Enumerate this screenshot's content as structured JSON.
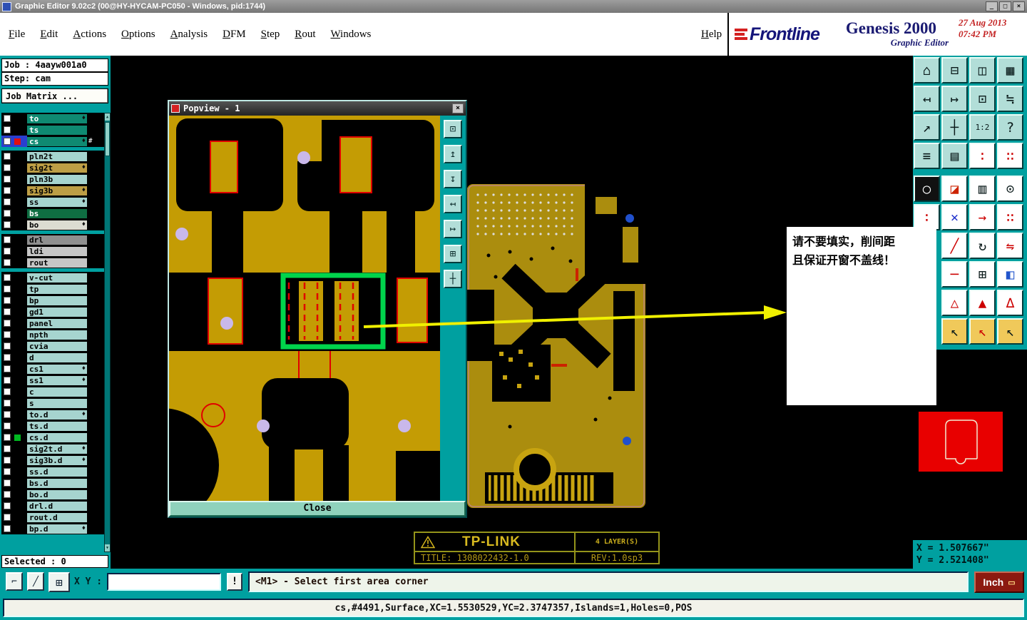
{
  "window": {
    "title": "Graphic Editor 9.02c2 (00@HY-HYCAM-PC050 - Windows, pid:1744)",
    "controls": {
      "minimize": "_",
      "maximize": "□",
      "close": "×"
    }
  },
  "menubar": {
    "items": [
      "File",
      "Edit",
      "Actions",
      "Options",
      "Analysis",
      "DFM",
      "Step",
      "Rout",
      "Windows"
    ],
    "help": "Help"
  },
  "branding": {
    "logo": "Frontline",
    "product": "Genesis 2000",
    "date": "27 Aug 2013",
    "time": "07:42 PM",
    "subtitle": "Graphic Editor"
  },
  "job_panel": {
    "job_label": "Job : 4aayw001a0",
    "step_label": "Step: cam",
    "matrix_button": "Job Matrix ...",
    "selected_label": "Selected : 0"
  },
  "layers": [
    {
      "n": "to",
      "bg": "#0f8a72",
      "fg": "#ffffff",
      "dia": true
    },
    {
      "n": "ts",
      "bg": "#0f8a72",
      "fg": "#ffffff"
    },
    {
      "n": "cs",
      "bg": "#0f8a72",
      "fg": "#ffffff",
      "dia": true,
      "chip": "#e01010",
      "cb": "#2a3fd0",
      "sfx": "#"
    },
    {
      "n": "pln2t",
      "bg": "#a6d4cf",
      "gap": true
    },
    {
      "n": "sig2t",
      "bg": "#bd9e45",
      "dia": true
    },
    {
      "n": "pln3b",
      "bg": "#a6d4cf"
    },
    {
      "n": "sig3b",
      "bg": "#bd9e45",
      "dia": true
    },
    {
      "n": "ss",
      "bg": "#a6d4cf",
      "dia": true
    },
    {
      "n": "bs",
      "bg": "#0f6e42",
      "fg": "#ffffff"
    },
    {
      "n": "bo",
      "bg": "#dcdcd2",
      "dia": true
    },
    {
      "n": "drl",
      "bg": "#8f8f8f",
      "gap": true
    },
    {
      "n": "ldi",
      "bg": "#c6c6c6"
    },
    {
      "n": "rout",
      "bg": "#c6c6c6"
    },
    {
      "n": "v-cut",
      "bg": "#a6d4cf",
      "gap": true
    },
    {
      "n": "tp",
      "bg": "#a6d4cf"
    },
    {
      "n": "bp",
      "bg": "#a6d4cf"
    },
    {
      "n": "gd1",
      "bg": "#a6d4cf"
    },
    {
      "n": "panel",
      "bg": "#a6d4cf"
    },
    {
      "n": "npth",
      "bg": "#a6d4cf"
    },
    {
      "n": "cvia",
      "bg": "#a6d4cf"
    },
    {
      "n": "d",
      "bg": "#a6d4cf"
    },
    {
      "n": "cs1",
      "bg": "#a6d4cf",
      "dia": true
    },
    {
      "n": "ss1",
      "bg": "#a6d4cf",
      "dia": true
    },
    {
      "n": "c",
      "bg": "#a6d4cf"
    },
    {
      "n": "s",
      "bg": "#a6d4cf"
    },
    {
      "n": "to.d",
      "bg": "#a6d4cf",
      "dia": true
    },
    {
      "n": "ts.d",
      "bg": "#a6d4cf"
    },
    {
      "n": "cs.d",
      "bg": "#a6d4cf",
      "chip": "#00b820"
    },
    {
      "n": "sig2t.d",
      "bg": "#a6d4cf",
      "dia": true
    },
    {
      "n": "sig3b.d",
      "bg": "#a6d4cf",
      "dia": true
    },
    {
      "n": "ss.d",
      "bg": "#a6d4cf"
    },
    {
      "n": "bs.d",
      "bg": "#a6d4cf"
    },
    {
      "n": "bo.d",
      "bg": "#a6d4cf"
    },
    {
      "n": "drl.d",
      "bg": "#a6d4cf"
    },
    {
      "n": "rout.d",
      "bg": "#a6d4cf"
    },
    {
      "n": "bp.d",
      "bg": "#a6d4cf",
      "dia": true
    }
  ],
  "toolbar_right": {
    "rows": [
      [
        {
          "n": "home-view",
          "g": "⌂"
        },
        {
          "n": "fit-window",
          "g": "⊟"
        },
        {
          "n": "new-window",
          "g": "◫"
        },
        {
          "n": "grid-view",
          "g": "▦"
        }
      ],
      [
        {
          "n": "pan-screen-left",
          "g": "↤"
        },
        {
          "n": "pan-screen-right",
          "g": "↦"
        },
        {
          "n": "zoom-box",
          "g": "⊡"
        },
        {
          "n": "match-view",
          "g": "≒"
        }
      ],
      [
        {
          "n": "zoom-extents",
          "g": "↗"
        },
        {
          "n": "move-view",
          "g": "┼"
        },
        {
          "n": "scale-1-2",
          "g": "1:2",
          "small": true
        },
        {
          "n": "help-tool",
          "g": "?"
        }
      ],
      [
        {
          "n": "layer-stack",
          "g": "≡"
        },
        {
          "n": "snap-grid",
          "g": "▤"
        },
        {
          "n": "red-dash-column",
          "g": "∶",
          "c": "#cc0000",
          "bg": "#ffffff"
        },
        {
          "n": "red-dot-column",
          "g": "∷",
          "c": "#cc0000",
          "bg": "#ffffff"
        }
      ],
      [
        {
          "n": "pad-round-dark",
          "g": "○",
          "c": "#ffffff",
          "bg": "#111111"
        },
        {
          "n": "half-fill",
          "g": "◪",
          "c": "#cc2200",
          "bg": "#ffffff"
        },
        {
          "n": "ruler-measure",
          "g": "▥",
          "bg": "#ffffff"
        },
        {
          "n": "pad-target",
          "g": "⊙",
          "bg": "#ffffff"
        }
      ],
      [
        {
          "n": "connect-points",
          "g": "∶",
          "c": "#cc0000",
          "bg": "#ffffff"
        },
        {
          "n": "delete-x",
          "g": "×",
          "c": "#2233cc",
          "bg": "#ffffff"
        },
        {
          "n": "move-point",
          "g": "→",
          "c": "#cc0000",
          "bg": "#ffffff"
        },
        {
          "n": "duplicate-points",
          "g": "∷",
          "c": "#cc0000",
          "bg": "#ffffff"
        }
      ],
      [
        null,
        {
          "n": "diagonal-line",
          "g": "╱",
          "c": "#cc0000",
          "bg": "#ffffff"
        },
        {
          "n": "rotate",
          "g": "↻",
          "bg": "#ffffff"
        },
        {
          "n": "flip-mirror",
          "g": "⇋",
          "c": "#cc0000",
          "bg": "#ffffff"
        }
      ],
      [
        null,
        {
          "n": "horizontal-line",
          "g": "─",
          "c": "#cc0000",
          "bg": "#ffffff"
        },
        {
          "n": "origin-cross",
          "g": "⊞",
          "bg": "#ffffff"
        },
        {
          "n": "layer-swap",
          "g": "◧",
          "c": "#2255cc",
          "bg": "#ffffff"
        }
      ],
      [
        null,
        {
          "n": "triangle-outline",
          "g": "△",
          "c": "#cc0000",
          "bg": "#ffffff"
        },
        {
          "n": "triangle-filled",
          "g": "▲",
          "c": "#cc0000",
          "bg": "#ffffff"
        },
        {
          "n": "triangle-add",
          "g": "∆",
          "c": "#cc0000",
          "bg": "#ffffff"
        }
      ],
      [
        null,
        {
          "n": "select-cursor",
          "g": "↖",
          "bg": "#f0c95a"
        },
        {
          "n": "select-cursor-alt",
          "g": "↖",
          "c": "#cc0000",
          "bg": "#f0c95a"
        },
        {
          "n": "select-cursor-dots",
          "g": "↖",
          "bg": "#f0c95a"
        }
      ]
    ]
  },
  "popview": {
    "title": "Popview - 1",
    "close_icon": "×",
    "close_label": "Close",
    "tools": [
      {
        "n": "zoom-window",
        "g": "⊡"
      },
      {
        "n": "pan-up",
        "g": "↥"
      },
      {
        "n": "pan-down",
        "g": "↧"
      },
      {
        "n": "pan-left",
        "g": "↤"
      },
      {
        "n": "pan-right",
        "g": "↦"
      },
      {
        "n": "zoom-fit",
        "g": "⊞"
      },
      {
        "n": "center-view",
        "g": "┼"
      }
    ]
  },
  "annotation": {
    "line1": "请不要填实，削间距",
    "line2": "且保证开窗不盖线！"
  },
  "titleblock": {
    "company": "TP-LINK",
    "layers": "4 LAYER(S)",
    "title": "TITLE: 1308022432-1.0",
    "rev": "REV:1.0sp3"
  },
  "coords": {
    "x_readout": "X = 1.507667\"",
    "y_readout": "Y = 2.521408\""
  },
  "bottombar": {
    "tools": [
      {
        "n": "corner-mode",
        "g": "⌐"
      },
      {
        "n": "slope-mode",
        "g": "╱"
      },
      {
        "n": "grid-snap",
        "g": "⊞"
      }
    ],
    "xy_label": "X Y :",
    "xy_value": "",
    "bang": "!",
    "prompt": "<M1> - Select first area corner",
    "units": "Inch",
    "unit_icon": "▭"
  },
  "statusbar": {
    "text": "cs,#4491,Surface,XC=1.5530529,YC=2.3747357,Islands=1,Holes=0,POS"
  }
}
